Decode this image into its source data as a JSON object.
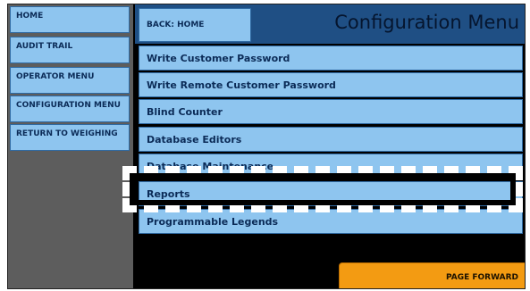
{
  "sidebar": {
    "items": [
      {
        "label": "HOME"
      },
      {
        "label": "AUDIT TRAIL"
      },
      {
        "label": "OPERATOR MENU"
      },
      {
        "label": "CONFIGURATION MENU"
      },
      {
        "label": "RETURN TO WEIGHING"
      }
    ]
  },
  "header": {
    "back_label": "BACK: HOME",
    "title": "Configuration Menu"
  },
  "menu": {
    "items": [
      {
        "label": "Write Customer Password"
      },
      {
        "label": "Write Remote Customer Password"
      },
      {
        "label": "Blind Counter"
      },
      {
        "label": "Database Editors"
      },
      {
        "label": "Database Maintenance"
      },
      {
        "label": "Reports"
      },
      {
        "label": "Programmable Legends"
      }
    ]
  },
  "footer": {
    "page_forward_label": "PAGE FORWARD"
  },
  "colors": {
    "button_fill": "#8ec5ef",
    "header_bg": "#1f4f84",
    "sidebar_bg": "#5d5d5d",
    "page_forward": "#f39b12"
  }
}
